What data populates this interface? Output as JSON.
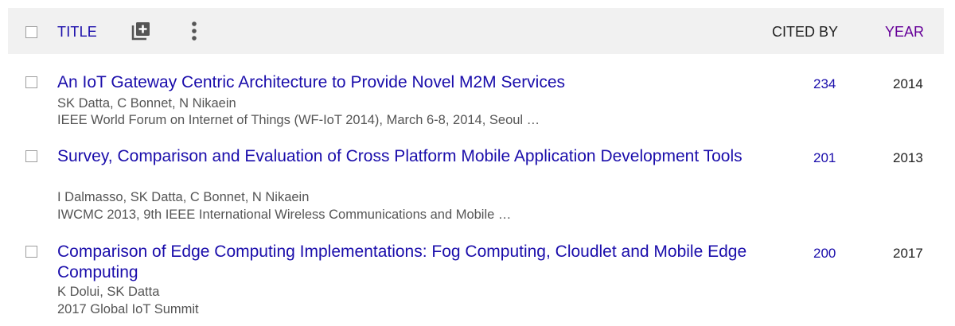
{
  "header": {
    "title_label": "TITLE",
    "cited_by_label": "CITED BY",
    "year_label": "YEAR",
    "icons": [
      "add-to-library-icon",
      "more-options-icon"
    ]
  },
  "articles": [
    {
      "title": "An IoT Gateway Centric Architecture to Provide Novel M2M Services",
      "authors": "SK Datta, C Bonnet, N Nikaein",
      "venue": "IEEE World Forum on Internet of Things (WF-IoT 2014), March 6-8, 2014, Seoul …",
      "cited_by": "234",
      "year": "2014"
    },
    {
      "title": "Survey, Comparison and Evaluation of Cross Platform Mobile Application Development Tools",
      "authors": "I Dalmasso, SK Datta, C Bonnet, N Nikaein",
      "venue": "IWCMC 2013, 9th IEEE International Wireless Communications and Mobile …",
      "cited_by": "201",
      "year": "2013"
    },
    {
      "title": "Comparison of Edge Computing Implementations: Fog Computing, Cloudlet and Mobile Edge Computing",
      "authors": "K Dolui, SK Datta",
      "venue": "2017 Global IoT Summit",
      "cited_by": "200",
      "year": "2017"
    }
  ],
  "colors": {
    "link": "#1a0dab",
    "year_header": "#660099",
    "header_bg": "#f1f1f1",
    "meta_text": "#555555"
  }
}
